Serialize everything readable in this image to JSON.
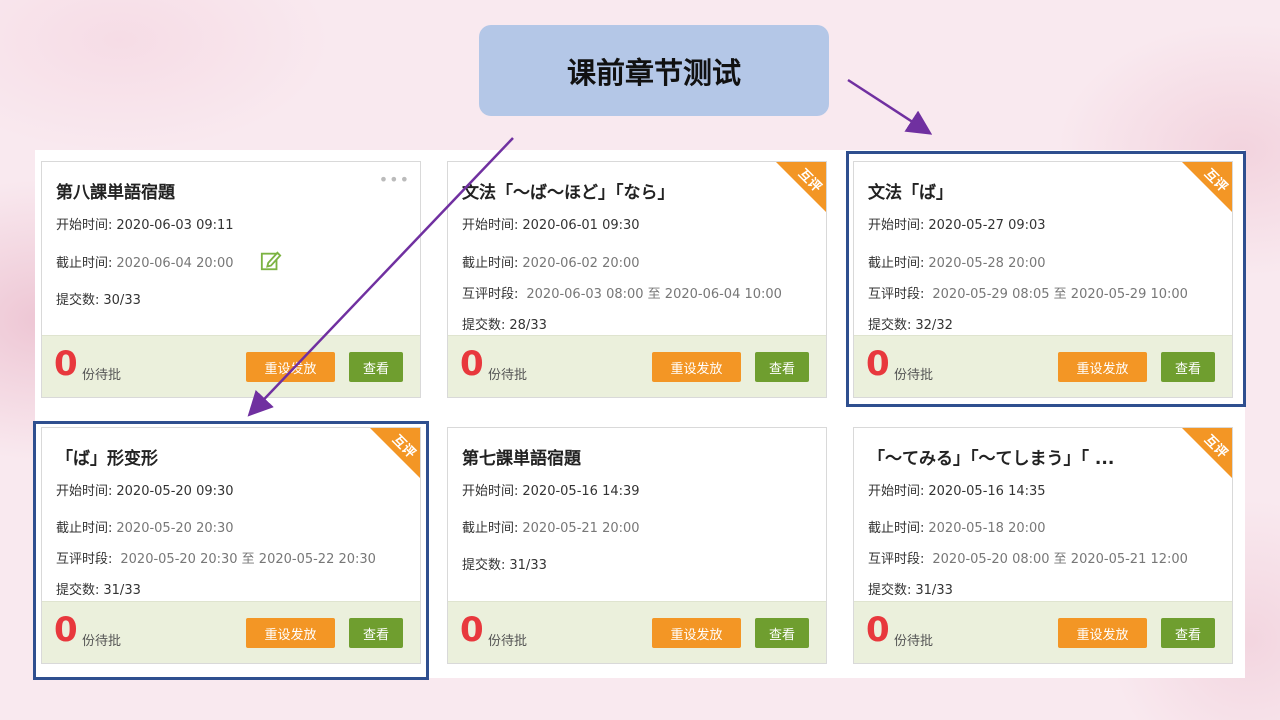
{
  "header": {
    "title": "课前章节测试"
  },
  "labels": {
    "start": "开始时间:",
    "deadline": "截止时间:",
    "peer": "互评时段:",
    "submissions": "提交数:",
    "pending": "份待批",
    "reset_button": "重设发放",
    "view_button": "查看",
    "peer_badge": "互评",
    "more": "•••",
    "range_sep": "至"
  },
  "cards": [
    {
      "title": "第八課単語宿題",
      "start": "2020-06-03 09:11",
      "deadline": "2020-06-04 20:00",
      "peer": "",
      "submissions": "30/33",
      "pending": "0"
    },
    {
      "title": "文法「～ば～ほど」「なら」",
      "start": "2020-06-01 09:30",
      "deadline": "2020-06-02 20:00",
      "peer": "2020-06-03 08:00 至 2020-06-04 10:00",
      "submissions": "28/33",
      "pending": "0"
    },
    {
      "title": "文法「ば」",
      "start": "2020-05-27 09:03",
      "deadline": "2020-05-28 20:00",
      "peer": "2020-05-29 08:05 至 2020-05-29 10:00",
      "submissions": "32/32",
      "pending": "0"
    },
    {
      "title": "「ば」形变形",
      "start": "2020-05-20 09:30",
      "deadline": "2020-05-20 20:30",
      "peer": "2020-05-20 20:30 至 2020-05-22 20:30",
      "submissions": "31/33",
      "pending": "0"
    },
    {
      "title": "第七課単語宿題",
      "start": "2020-05-16 14:39",
      "deadline": "2020-05-21 20:00",
      "peer": "",
      "submissions": "31/33",
      "pending": "0"
    },
    {
      "title": "「～てみる」「～てしまう」「 ...",
      "start": "2020-05-16 14:35",
      "deadline": "2020-05-18 20:00",
      "peer": "2020-05-20 08:00 至 2020-05-21 12:00",
      "submissions": "31/33",
      "pending": "0"
    }
  ],
  "colors": {
    "accent_orange": "#f39625",
    "view_green": "#6f9e2f",
    "count_red": "#e8383d",
    "highlight_blue": "#2f4f8f",
    "arrow_purple": "#7030a0"
  }
}
